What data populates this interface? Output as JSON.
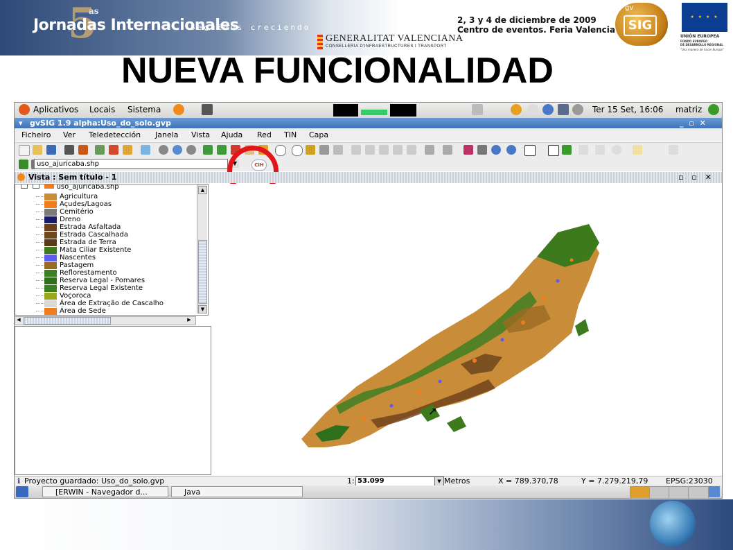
{
  "slide": {
    "brand": "Jornadas Internacionales",
    "brand_subtitle": "Seguimos creciendo",
    "edition_number": "5",
    "edition_suffix": "as",
    "sponsor": "GENERALITAT VALENCIANA",
    "sponsor_sub": "CONSELLERIA D'INFRAESTRUCTURES I TRANSPORT",
    "event_dates": "2, 3 y 4 de diciembre de 2009",
    "event_place": "Centro de eventos. Feria Valencia",
    "gvsig_logo_top": "gv",
    "gvsig_logo_text": "SIG",
    "eu_title": "UNIÓN EUROPEA",
    "eu_fund_1": "FONDO EUROPEO",
    "eu_fund_2": "DE DESARROLLO REGIONAL",
    "eu_motto": "\"Una manera de hacer Europa\"",
    "title": "NUEVA FUNCIONALIDAD"
  },
  "desktop_panel": {
    "menu_apps": "Aplicativos",
    "menu_places": "Locais",
    "menu_system": "Sistema",
    "clock": "Ter 15 Set, 16:06",
    "user": "matriz"
  },
  "window": {
    "title": "gvSIG 1.9 alpha:Uso_do_solo.gvp",
    "controls": "_ ▫ ✕",
    "menu": [
      "Ficheiro",
      "Ver",
      "Teledetección",
      "Janela",
      "Vista",
      "Ajuda",
      "Red",
      "TIN",
      "Capa"
    ],
    "layer_select": "uso_ajuricaba.shp",
    "layer_tool_label": "CIH",
    "view_title": "Vista : Sem título - 1",
    "view_controls": "▫ ▫ ✕"
  },
  "toc": {
    "layer_name": "uso_ajuricaba.shp",
    "legend": [
      {
        "label": "Agricultura",
        "color": "#c98d3a"
      },
      {
        "label": "Açudes/Lagoas",
        "color": "#f07d1d"
      },
      {
        "label": "Cemitério",
        "color": "#7a7a7a"
      },
      {
        "label": "Dreno",
        "color": "#1b1b6b"
      },
      {
        "label": "Estrada Asfaltada",
        "color": "#6b3f1a"
      },
      {
        "label": "Estrada Cascalhada",
        "color": "#6f4a1e"
      },
      {
        "label": "Estrada de Terra",
        "color": "#5a3818"
      },
      {
        "label": "Mata Ciliar Existente",
        "color": "#3d7a1d"
      },
      {
        "label": "Nascentes",
        "color": "#5b5bf0"
      },
      {
        "label": "Pastagem",
        "color": "#9a6a23"
      },
      {
        "label": "Reflorestamento",
        "color": "#3f7f23"
      },
      {
        "label": "Reserva Legal - Pomares",
        "color": "#2e6f1c"
      },
      {
        "label": "Reserva Legal Existente",
        "color": "#3b7e1f"
      },
      {
        "label": "Voçoroca",
        "color": "#9aa81a"
      },
      {
        "label": "Área de Extração de Cascalho",
        "color": "#d9d9d9"
      },
      {
        "label": "Área de Sede",
        "color": "#f07d1d"
      }
    ]
  },
  "status": {
    "message": "Proyecto guardado: Uso_do_solo.gvp",
    "scale_prefix": "1:",
    "scale": "53.099",
    "units": "Metros",
    "x": "X = 789.370,78",
    "y": "Y = 7.279.219,79",
    "epsg": "EPSG:23030"
  },
  "taskbar": {
    "task_1": "[ERWIN - Navegador d...",
    "task_2": "Java"
  }
}
